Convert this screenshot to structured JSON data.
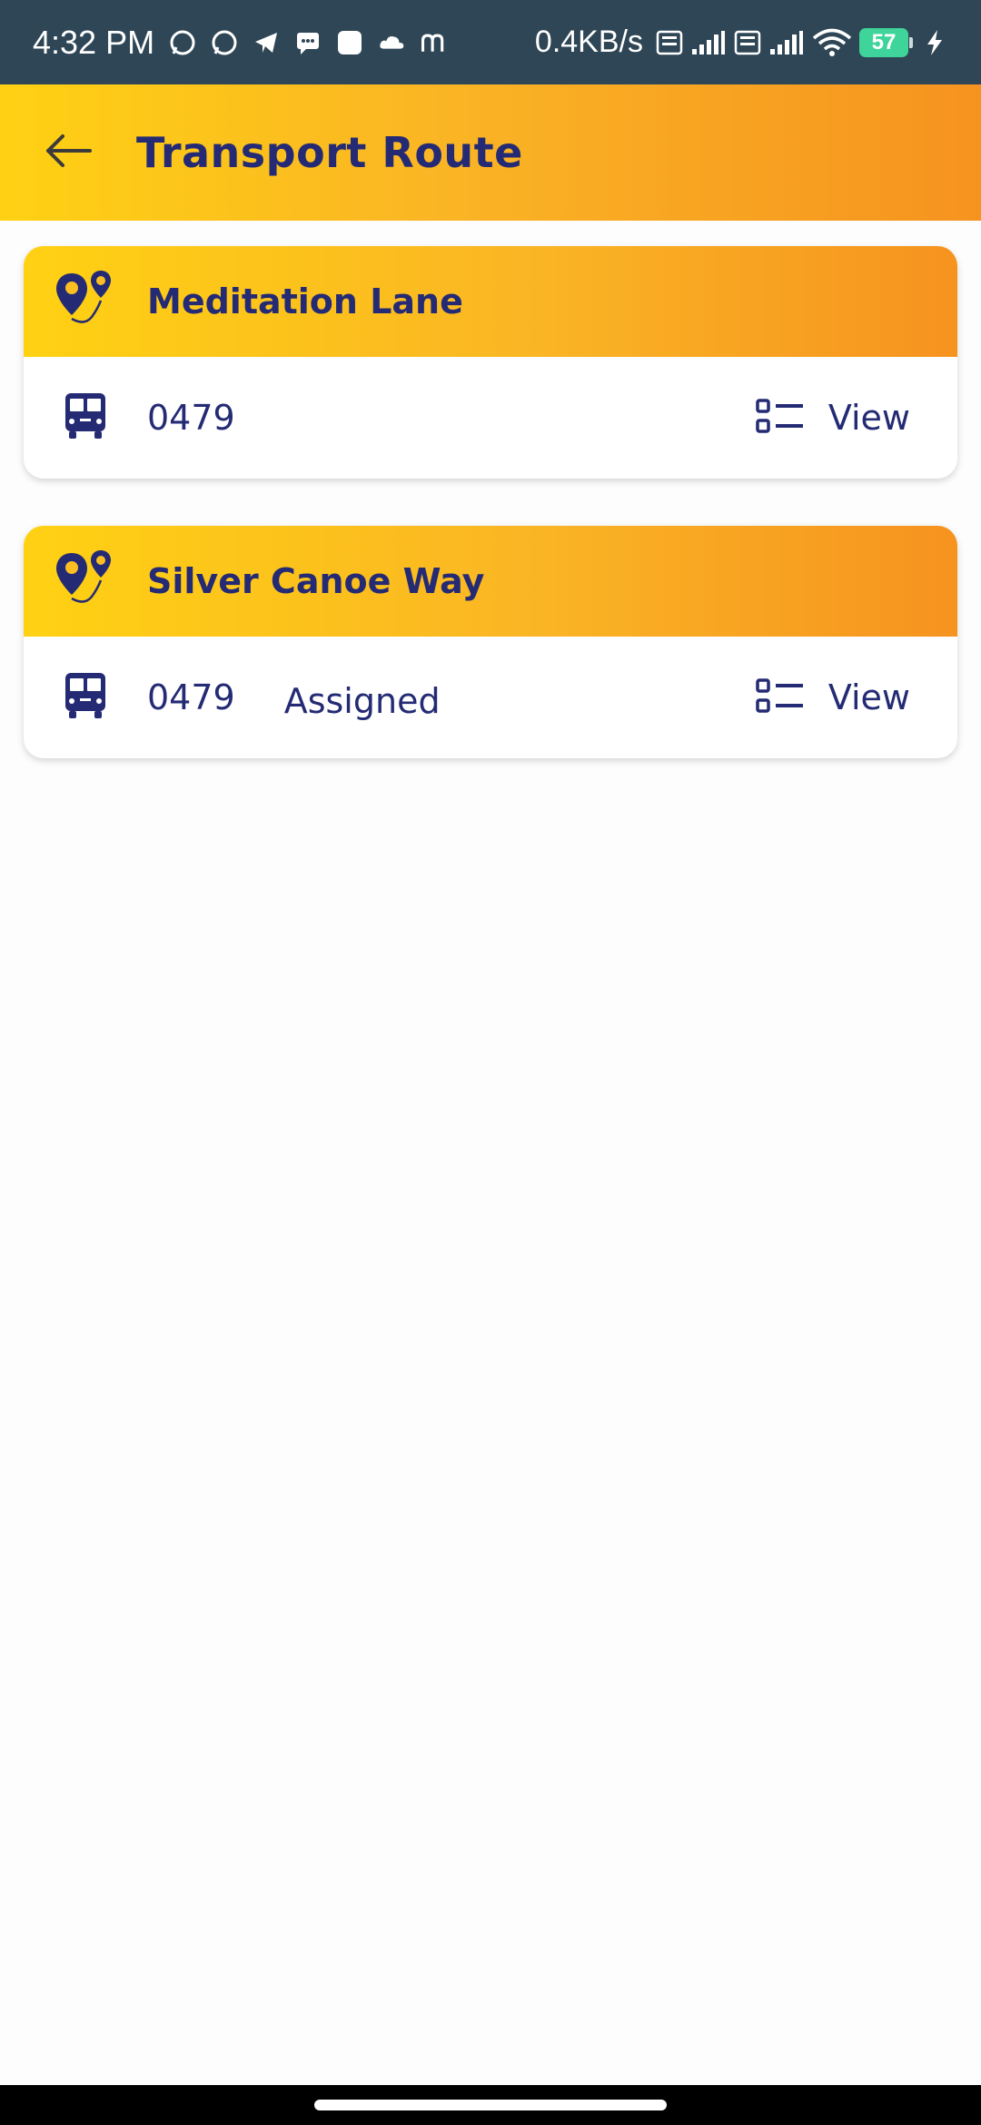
{
  "status_bar": {
    "time": "4:32 PM",
    "network_speed": "0.4KB/s",
    "battery": "57",
    "icons": [
      "whatsapp-icon",
      "whatsapp-business-icon",
      "telegram-icon",
      "message-icon",
      "app-icon",
      "cloud-icon",
      "m-icon",
      "volte-icon",
      "signal-icon",
      "volte-icon",
      "signal-icon",
      "wifi-icon",
      "battery-icon",
      "charging-icon"
    ]
  },
  "app_bar": {
    "title": "Transport Route",
    "back_icon": "arrow-left-icon"
  },
  "routes": [
    {
      "name": "Meditation Lane",
      "code": "0479",
      "status": "",
      "view_label": "View"
    },
    {
      "name": "Silver Canoe Way",
      "code": "0479",
      "status": "Assigned",
      "view_label": "View"
    }
  ],
  "colors": {
    "primary_text": "#242b74",
    "gradient_start": "#ffd113",
    "gradient_end": "#f6931f",
    "status_bar": "#2e4656"
  }
}
